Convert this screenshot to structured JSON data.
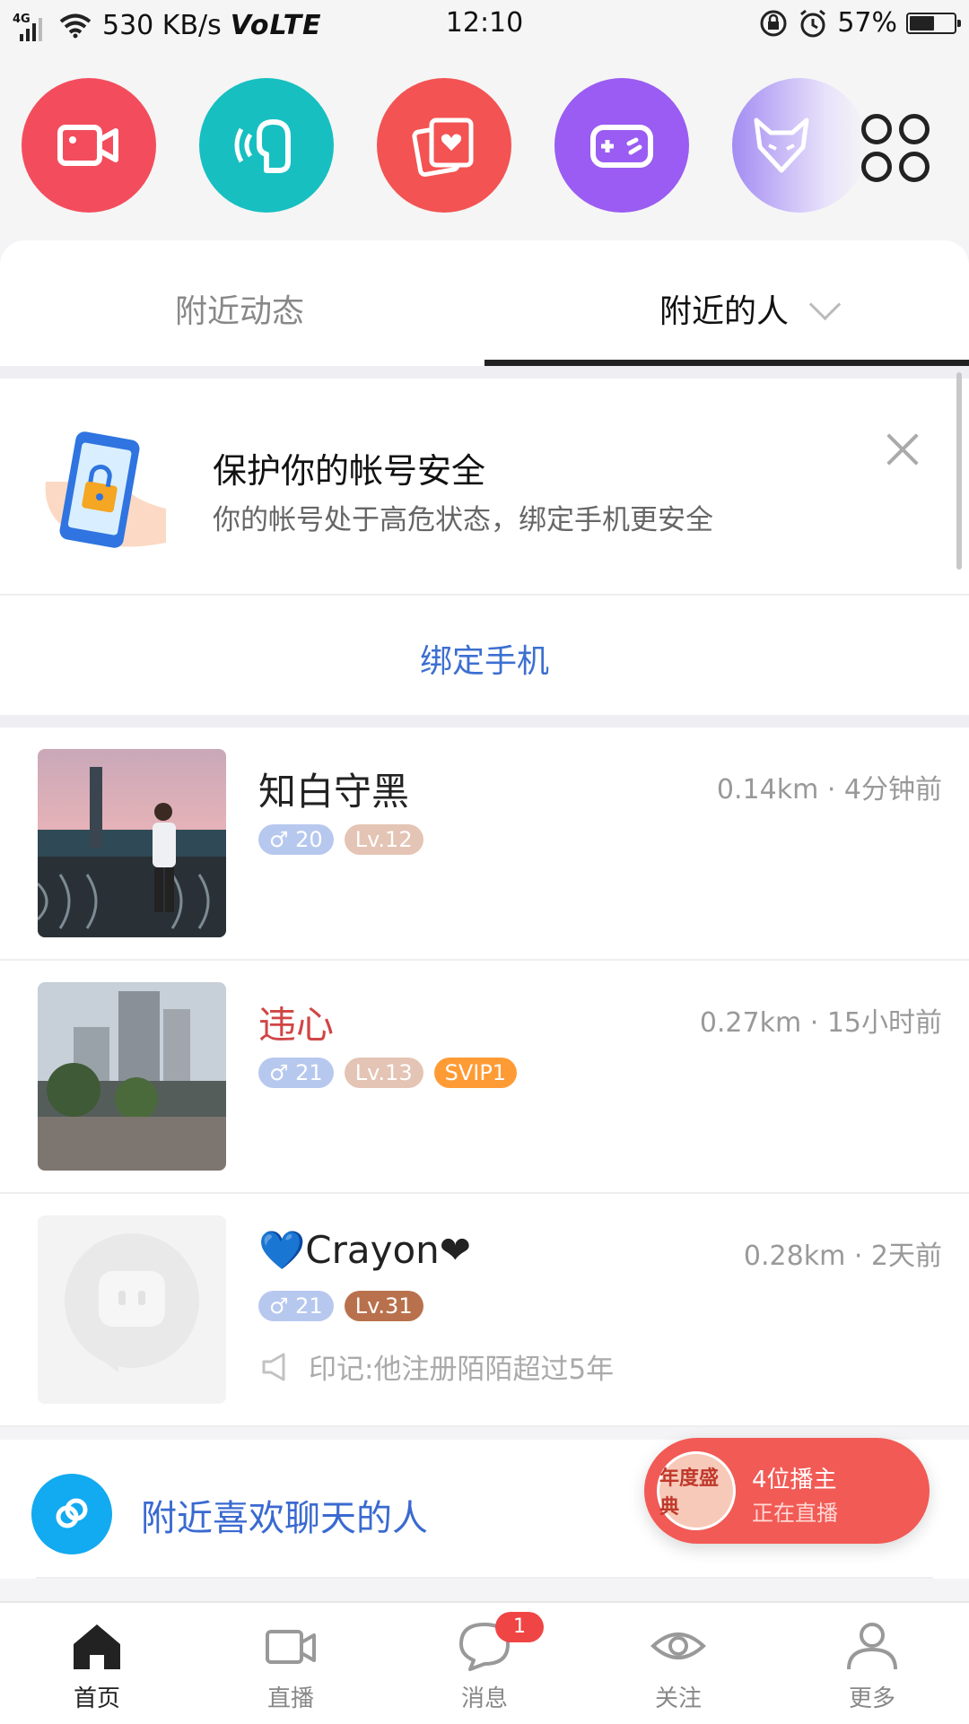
{
  "status_bar": {
    "network_tag": "4G",
    "speed": "530 KB/s",
    "volte": "VoLTE",
    "time": "12:10",
    "battery": "57%",
    "battery_level": 0.57
  },
  "shortcuts": [
    {
      "name": "video-camera-icon",
      "color": "#f34d5d"
    },
    {
      "name": "voice-chat-icon",
      "color": "#17bfc1"
    },
    {
      "name": "photo-heart-icon",
      "color": "#f35353"
    },
    {
      "name": "gamepad-icon",
      "color": "#9a5cf2"
    },
    {
      "name": "wolf-icon",
      "color": "#b3a0f5"
    }
  ],
  "tabs": {
    "left": "附近动态",
    "right": "附近的人"
  },
  "security": {
    "title": "保护你的帐号安全",
    "subtitle": "你的帐号处于高危状态，绑定手机更安全",
    "action": "绑定手机"
  },
  "users": [
    {
      "name": "知白守黑",
      "distance": "0.14km · 4分钟前",
      "age": "20",
      "level": "Lv.12",
      "vip": "",
      "mark": ""
    },
    {
      "name": "违心",
      "distance": "0.27km · 15小时前",
      "age": "21",
      "level": "Lv.13",
      "vip": "SVIP1",
      "mark": ""
    },
    {
      "name": "💙Crayon❤",
      "distance": "0.28km · 2天前",
      "age": "21",
      "level": "Lv.31",
      "vip": "",
      "mark": "印记:他注册陌陌超过5年"
    }
  ],
  "nearby_chat": {
    "label": "附近喜欢聊天的人"
  },
  "live": {
    "count_text": "4位播主",
    "status_text": "正在直播",
    "avatar_text": "年度盛典"
  },
  "nav": {
    "home": "首页",
    "live": "直播",
    "messages": "消息",
    "messages_badge": "1",
    "follow": "关注",
    "more": "更多"
  }
}
